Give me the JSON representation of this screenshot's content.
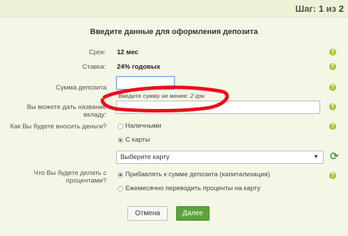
{
  "header": {
    "step_label": "Шаг:",
    "step_current": "1",
    "step_separator": "из",
    "step_total": "2"
  },
  "form": {
    "title": "Введите данные для оформления депозита",
    "term": {
      "label": "Срок:",
      "value": "12 мес"
    },
    "rate": {
      "label": "Ставка:",
      "value": "24% годовых"
    },
    "amount": {
      "label": "Сумма депозита",
      "value": "",
      "hint_prefix": "Введите сумму не менее:",
      "hint_value": "2 грн"
    },
    "name": {
      "label": "Вы можете дать название вкладу:",
      "value": ""
    },
    "payment": {
      "label": "Как Вы будете вносить деньги?",
      "options": [
        {
          "label": "Наличными",
          "checked": false
        },
        {
          "label": "С карты",
          "checked": true
        }
      ],
      "card_select": {
        "value": "Выберите карту"
      }
    },
    "interest": {
      "label_line1": "Что Вы будете делать с",
      "label_line2": "процентами?",
      "options": [
        {
          "label": "Прибавлять к сумме депозита (капитализация)",
          "checked": true
        },
        {
          "label": "Ежемесячно переводить проценты на карту",
          "checked": false
        }
      ]
    }
  },
  "buttons": {
    "cancel": "Отмена",
    "next": "Далее"
  },
  "help_glyph": "?",
  "colors": {
    "accent_green": "#5aa43a",
    "help_green": "#a9c23a",
    "annotation_red": "#e8101a"
  }
}
